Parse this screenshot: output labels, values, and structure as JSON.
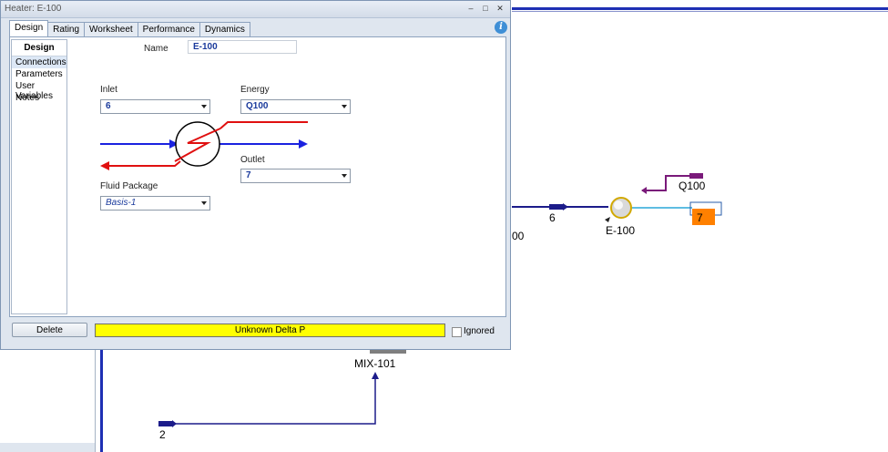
{
  "window": {
    "title": "Heater: E-100",
    "buttons": [
      "–",
      "□",
      "✕"
    ]
  },
  "tabs": [
    {
      "label": "Design",
      "active": true
    },
    {
      "label": "Rating",
      "active": false
    },
    {
      "label": "Worksheet",
      "active": false
    },
    {
      "label": "Performance",
      "active": false
    },
    {
      "label": "Dynamics",
      "active": false
    }
  ],
  "nav": {
    "header": "Design",
    "items": [
      "Connections",
      "Parameters",
      "User Variables",
      "Notes"
    ],
    "selected": "Connections"
  },
  "form": {
    "name_label": "Name",
    "name_value": "E-100",
    "inlet_label": "Inlet",
    "inlet_value": "6",
    "energy_label": "Energy",
    "energy_value": "Q100",
    "outlet_label": "Outlet",
    "outlet_value": "7",
    "fluid_label": "Fluid Package",
    "fluid_value": "Basis-1"
  },
  "footer": {
    "delete_label": "Delete",
    "status_text": "Unknown Delta P",
    "status_color": "#ffff00",
    "ignored_label": "Ignored",
    "ignored_checked": false
  },
  "pfd": {
    "labels": {
      "stream6": "6",
      "heater": "E-100",
      "energy": "Q100",
      "outlet": "7",
      "mixer": "MIX-101",
      "stream2": "2",
      "partial": "00"
    },
    "colors": {
      "material": "#1c1c8a",
      "energy": "#7a1a7a",
      "outlet_stream": "#2aa7d8",
      "outlet_box": "#ff8000"
    }
  }
}
